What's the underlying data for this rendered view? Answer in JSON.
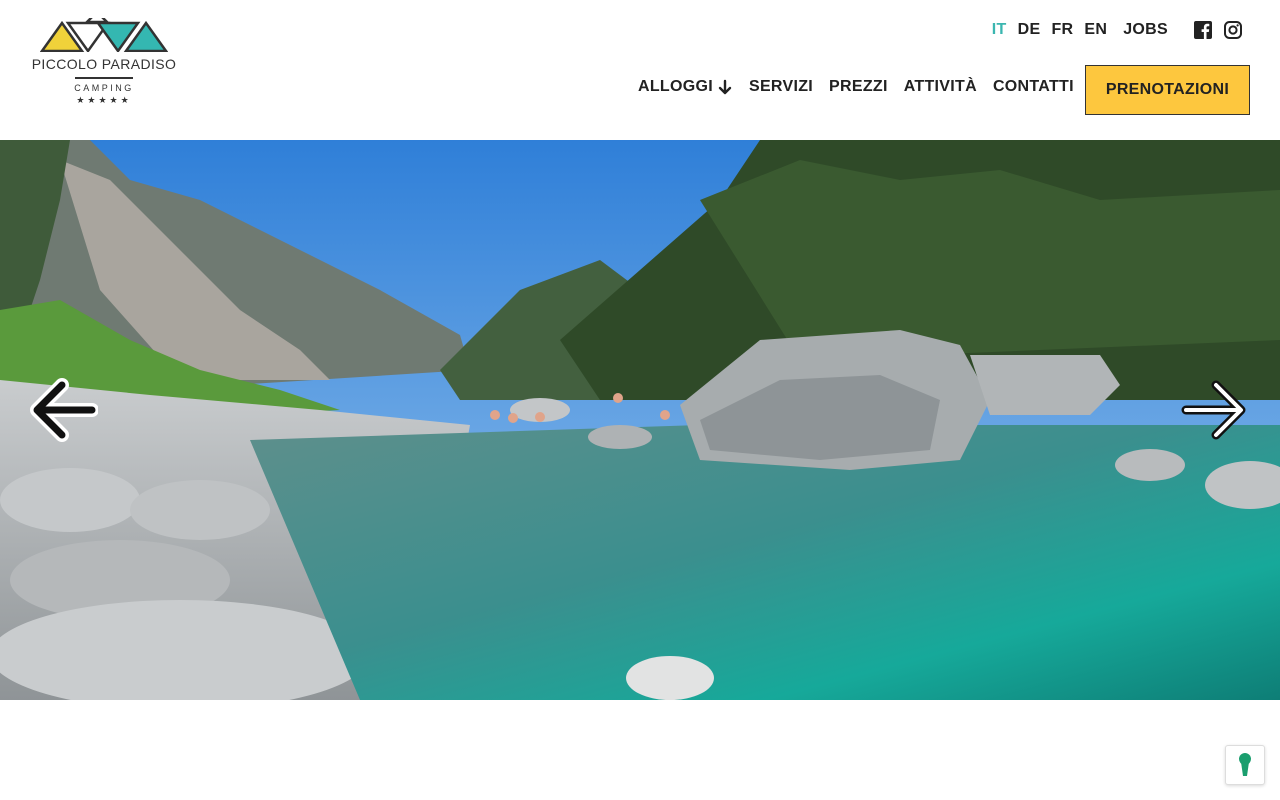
{
  "brand": {
    "name": "PICCOLO PARADISO",
    "subtitle": "CAMPING",
    "stars": "★★★★★",
    "colors": {
      "yellow": "#f0d23a",
      "teal": "#34b7b1",
      "dark": "#333333"
    }
  },
  "languages": [
    {
      "code": "IT",
      "active": true
    },
    {
      "code": "DE",
      "active": false
    },
    {
      "code": "FR",
      "active": false
    },
    {
      "code": "EN",
      "active": false
    }
  ],
  "jobs_label": "JOBS",
  "social": {
    "facebook": "facebook-icon",
    "instagram": "instagram-icon"
  },
  "nav": {
    "items": [
      {
        "label": "ALLOGGI",
        "has_dropdown": true,
        "arrow": "🡣"
      },
      {
        "label": "SERVIZI"
      },
      {
        "label": "PREZZI"
      },
      {
        "label": "ATTIVITÀ"
      },
      {
        "label": "CONTATTI"
      }
    ],
    "cta_label": "PRENOTAZIONI",
    "cta_color": "#fdc73e"
  },
  "hero": {
    "image": "river-valley-photo",
    "prev_icon": "arrow-left-icon",
    "next_icon": "arrow-right-icon"
  },
  "cookie": {
    "icon": "keyhole-icon",
    "color": "#1a9e6e"
  }
}
